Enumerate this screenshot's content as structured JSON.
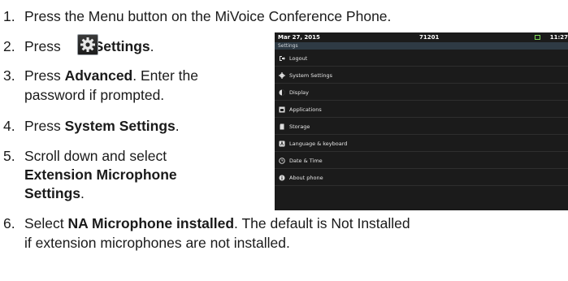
{
  "steps": [
    {
      "num": "1.",
      "text": "Press the Menu button on the MiVoice Conference Phone."
    },
    {
      "num": "2.",
      "pre": "Press",
      "bold": "Settings",
      "post": "."
    },
    {
      "num": "3.",
      "pre": "Press",
      "bold": "Advanced",
      "post": ". Enter the",
      "line2": "password if prompted."
    },
    {
      "num": "4.",
      "pre": "Press",
      "bold": "System Settings",
      "post": "."
    },
    {
      "num": "5.",
      "pre": "Scroll down and select",
      "bold_line2": "Extension Microphone",
      "bold_line3": "Settings",
      "post": "."
    },
    {
      "num": "6.",
      "pre": "Select",
      "bold": "NA Microphone installed",
      "post": ". The default is Not Installed",
      "line2": "if extension microphones are not installed."
    }
  ],
  "phone": {
    "date": "Mar 27, 2015",
    "extension": "71201",
    "time": "11:27",
    "screen_title": "Settings",
    "menu_items": [
      {
        "label": "Logout",
        "icon": "logout-icon"
      },
      {
        "label": "System Settings",
        "icon": "gear-icon"
      },
      {
        "label": "Display",
        "icon": "display-icon"
      },
      {
        "label": "Applications",
        "icon": "applications-icon"
      },
      {
        "label": "Storage",
        "icon": "storage-icon"
      },
      {
        "label": "Language & keyboard",
        "icon": "language-icon"
      },
      {
        "label": "Date & Time",
        "icon": "clock-icon"
      },
      {
        "label": "About phone",
        "icon": "info-icon"
      }
    ],
    "accent_battery_color": "#7ed957"
  }
}
